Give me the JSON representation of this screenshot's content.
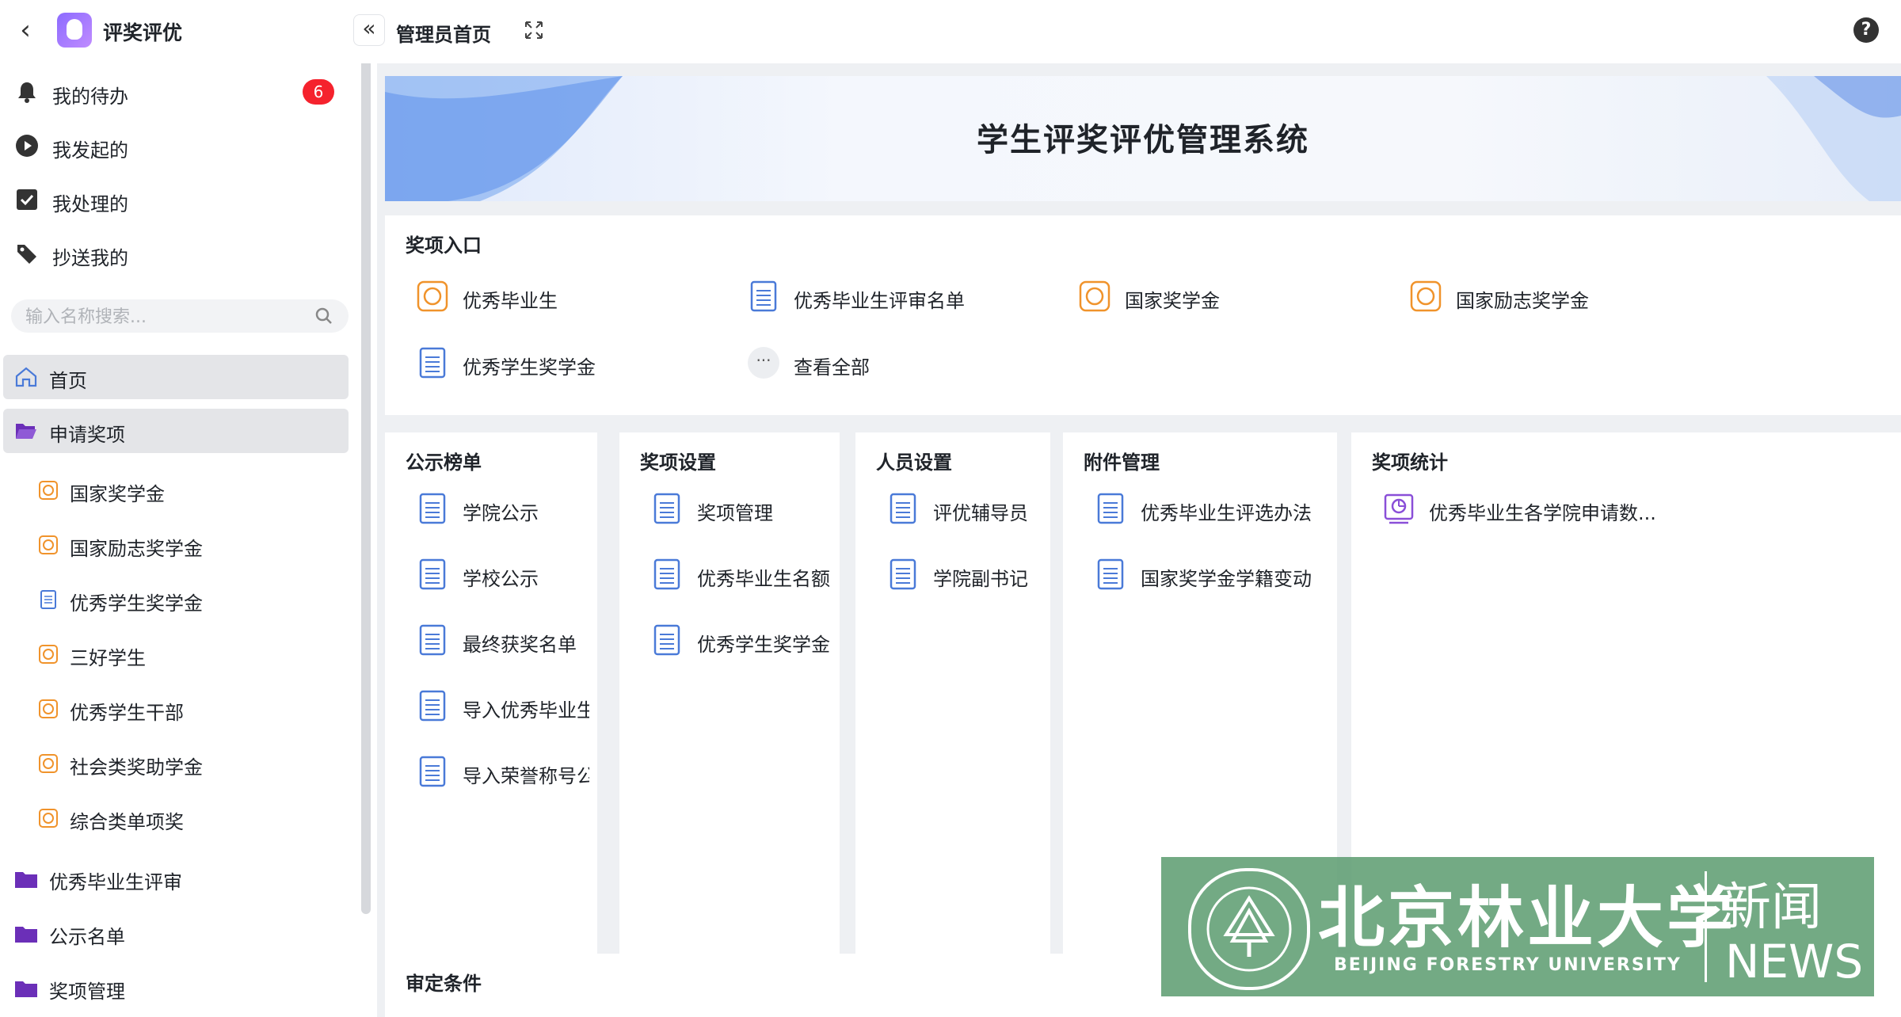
{
  "app": {
    "title": "评奖评优"
  },
  "quick_links": [
    {
      "label": "我的待办",
      "badge": "6",
      "icon": "bell-icon"
    },
    {
      "label": "我发起的",
      "icon": "play-circle-icon"
    },
    {
      "label": "我处理的",
      "icon": "checkbox-icon"
    },
    {
      "label": "抄送我的",
      "icon": "tag-icon"
    }
  ],
  "search": {
    "placeholder": "输入名称搜索..."
  },
  "nav": {
    "home": "首页",
    "apply": "申请奖项",
    "apply_items": [
      "国家奖学金",
      "国家励志奖学金",
      "优秀学生奖学金",
      "三好学生",
      "优秀学生干部",
      "社会类奖助学金",
      "综合类单项奖"
    ],
    "folders": [
      "优秀毕业生评审",
      "公示名单",
      "奖项管理"
    ]
  },
  "header": {
    "tab": "管理员首页"
  },
  "banner": {
    "title": "学生评奖评优管理系统"
  },
  "award_entry": {
    "title": "奖项入口",
    "items": [
      "优秀毕业生",
      "优秀毕业生评审名单",
      "国家奖学金",
      "国家励志奖学金",
      "优秀学生奖学金"
    ],
    "view_all": "查看全部"
  },
  "panels": [
    {
      "title": "公示榜单",
      "items": [
        "学院公示",
        "学校公示",
        "最终获奖名单",
        "导入优秀毕业生",
        "导入荣誉称号公"
      ]
    },
    {
      "title": "奖项设置",
      "items": [
        "奖项管理",
        "优秀毕业生名额",
        "优秀学生奖学金"
      ]
    },
    {
      "title": "人员设置",
      "items": [
        "评优辅导员",
        "学院副书记"
      ]
    },
    {
      "title": "附件管理",
      "items": [
        "优秀毕业生评选办法",
        "国家奖学金学籍变动"
      ]
    },
    {
      "title": "奖项统计",
      "items": [
        "优秀毕业生各学院申请数..."
      ]
    }
  ],
  "bottom_card": {
    "title": "审定条件"
  },
  "watermark": {
    "cn": "北京林业大学",
    "en": "BEIJING FORESTRY UNIVERSITY",
    "news_cn": "新闻",
    "news_en": "NEWS"
  },
  "colors": {
    "accent_orange": "#f0932b",
    "doc_blue": "#4a7ad8",
    "badge_red": "#f5222d",
    "stat_purple": "#8a4fd8",
    "folder_purple": "#6b2fb8"
  }
}
